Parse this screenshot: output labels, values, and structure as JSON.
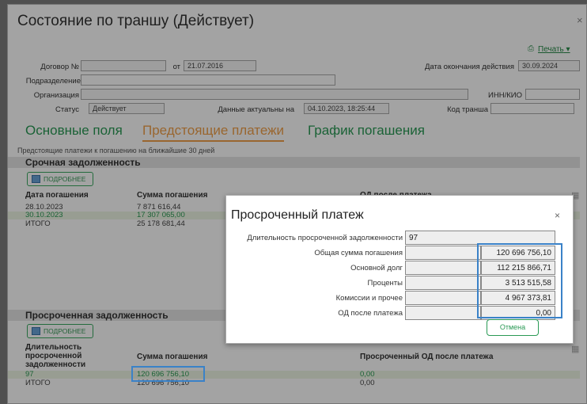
{
  "window": {
    "title": "Состояние по траншу (Действует)",
    "close": "×",
    "print_label": "Печать",
    "print_icon": "printer-icon"
  },
  "header_fields": {
    "contract_label": "Договор №",
    "contract_value": "",
    "from_label": "от",
    "from_value": "21.07.2016",
    "end_label": "Дата окончания действия",
    "end_value": "30.09.2024",
    "division_label": "Подразделение",
    "org_label": "Организация",
    "inn_label": "ИНН/КИО",
    "status_label": "Статус",
    "status_value": "Действует",
    "actual_label": "Данные актуальны на",
    "actual_value": "04.10.2023, 18:25:44",
    "tranche_label": "Код транша"
  },
  "tabs": [
    {
      "label": "Основные поля",
      "active": false
    },
    {
      "label": "Предстоящие платежи",
      "active": true
    },
    {
      "label": "График погашения",
      "active": false
    }
  ],
  "note": "Предстоящие платежи к погашению на ближайшие 30 дней",
  "urgent": {
    "title": "Срочная задолженность",
    "more_label": "ПОДРОБНЕЕ",
    "headers": [
      "Дата погашения",
      "Сумма погашения",
      "ОД после платежа"
    ],
    "rows": [
      {
        "date": "28.10.2023",
        "sum": "7 871 616,44"
      },
      {
        "date": "30.10.2023",
        "sum": "17 307 065,00"
      },
      {
        "date": "ИТОГО",
        "sum": "25 178 681,44"
      }
    ]
  },
  "overdue": {
    "title": "Просроченная задолженность",
    "more_label": "ПОДРОБНЕЕ",
    "headers": [
      "Длительность просроченной задолженности",
      "Сумма погашения",
      "Просроченный ОД после платежа"
    ],
    "rows": [
      {
        "duration": "97",
        "sum": "120 696 756,10",
        "od": "0,00"
      },
      {
        "duration": "ИТОГО",
        "sum": "120 696 756,10",
        "od": "0,00"
      }
    ]
  },
  "modal": {
    "title": "Просроченный платеж",
    "close": "×",
    "duration_label": "Длительность просроченной задолженности",
    "duration_value": "97",
    "rows": [
      {
        "label": "Общая сумма погашения",
        "value": "120 696 756,10"
      },
      {
        "label": "Основной долг",
        "value": "112 215 866,71"
      },
      {
        "label": "Проценты",
        "value": "3 513 515,58"
      },
      {
        "label": "Комиссии и прочее",
        "value": "4 967 373,81"
      },
      {
        "label": "ОД после платежа",
        "value": "0,00"
      }
    ],
    "cancel_label": "Отмена"
  }
}
